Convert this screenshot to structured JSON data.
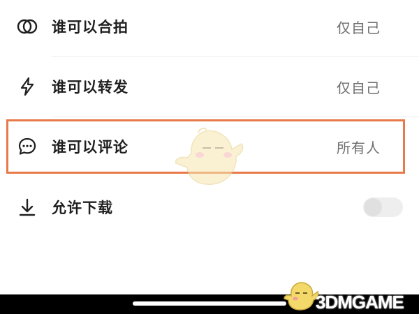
{
  "settings": [
    {
      "label": "谁可以合拍",
      "value": "仅自己",
      "icon": "duet-icon"
    },
    {
      "label": "谁可以转发",
      "value": "仅自己",
      "icon": "lightning-icon"
    },
    {
      "label": "谁可以评论",
      "value": "所有人",
      "icon": "comment-icon"
    },
    {
      "label": "允许下载",
      "icon": "download-icon",
      "toggle_on": false
    }
  ],
  "watermark": {
    "text": "3DMGAME"
  },
  "colors": {
    "highlight": "#e8794a",
    "value_text": "#6e6e6e",
    "toggle_off": "#eeeeee"
  }
}
